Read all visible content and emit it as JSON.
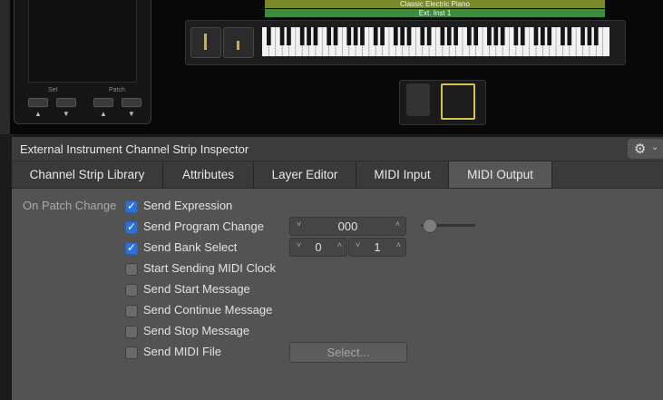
{
  "device": {
    "set_label": "Set",
    "patch_label": "Patch",
    "arrows": [
      "▲",
      "▼",
      "▲",
      "▼"
    ]
  },
  "track_slots": [
    "Classic Electric Piano",
    "Ext. Inst 1"
  ],
  "inspector": {
    "title": "External Instrument Channel Strip Inspector",
    "gear_icon": "⚙",
    "chevron": "⌄"
  },
  "tabs": [
    {
      "label": "Channel Strip Library",
      "active": false
    },
    {
      "label": "Attributes",
      "active": false
    },
    {
      "label": "Layer Editor",
      "active": false
    },
    {
      "label": "MIDI Input",
      "active": false
    },
    {
      "label": "MIDI Output",
      "active": true
    }
  ],
  "on_patch_change_label": "On Patch Change",
  "options": [
    {
      "label": "Send Expression",
      "checked": true
    },
    {
      "label": "Send Program Change",
      "checked": true
    },
    {
      "label": "Send Bank Select",
      "checked": true
    },
    {
      "label": "Start Sending MIDI Clock",
      "checked": false
    },
    {
      "label": "Send Start Message",
      "checked": false
    },
    {
      "label": "Send Continue Message",
      "checked": false
    },
    {
      "label": "Send Stop Message",
      "checked": false
    },
    {
      "label": "Send MIDI File",
      "checked": false
    }
  ],
  "program_change_value": "000",
  "bank_select_msb": "0",
  "bank_select_lsb": "1",
  "stepper_glyphs": {
    "down": "˅",
    "up": "˄"
  },
  "select_button_label": "Select...",
  "colors": {
    "accent": "#2f6fd6",
    "slot1": "#7a8a2a",
    "slot2": "#3f8a3f",
    "pedal_highlight": "#d9c24a"
  }
}
